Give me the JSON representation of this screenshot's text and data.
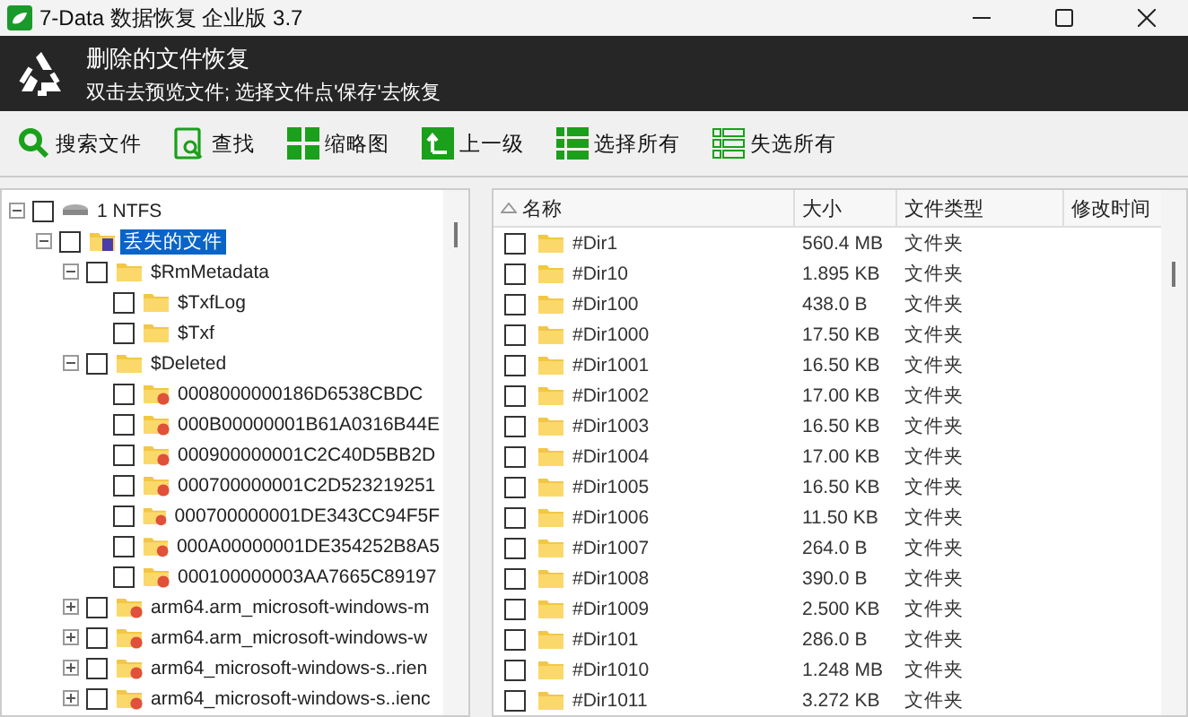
{
  "window": {
    "title": "7-Data 数据恢复 企业版 3.7"
  },
  "header": {
    "title": "删除的文件恢复",
    "subtitle": "双击去预览文件; 选择文件点'保存'去恢复"
  },
  "toolbar": [
    {
      "kind": "search",
      "label": "搜索文件"
    },
    {
      "kind": "find",
      "label": "查找"
    },
    {
      "kind": "thumbs",
      "label": "缩略图"
    },
    {
      "kind": "up",
      "label": "上一级"
    },
    {
      "kind": "selectall",
      "label": "选择所有"
    },
    {
      "kind": "deselect",
      "label": "失选所有"
    }
  ],
  "tree": [
    {
      "kind": "drive",
      "label": "1 NTFS",
      "checked": false,
      "selected": false,
      "expanded": true,
      "children": [
        {
          "kind": "lost",
          "label": "丢失的文件",
          "checked": false,
          "selected": true,
          "expanded": true,
          "children": [
            {
              "kind": "folder",
              "label": "$RmMetadata",
              "checked": false,
              "selected": false,
              "expanded": true,
              "children": [
                {
                  "kind": "folder",
                  "label": "$TxfLog",
                  "checked": false,
                  "selected": false
                },
                {
                  "kind": "folder",
                  "label": "$Txf",
                  "checked": false,
                  "selected": false
                }
              ]
            },
            {
              "kind": "folder",
              "label": "$Deleted",
              "checked": false,
              "selected": false,
              "expanded": true,
              "children": [
                {
                  "kind": "deleted",
                  "label": "0008000000186D6538CBDC",
                  "checked": false,
                  "selected": false
                },
                {
                  "kind": "deleted",
                  "label": "000B00000001B61A0316B44E",
                  "checked": false,
                  "selected": false
                },
                {
                  "kind": "deleted",
                  "label": "000900000001C2C40D5BB2D",
                  "checked": false,
                  "selected": false
                },
                {
                  "kind": "deleted",
                  "label": "000700000001C2D523219251",
                  "checked": false,
                  "selected": false
                },
                {
                  "kind": "deleted",
                  "label": "000700000001DE343CC94F5F",
                  "checked": false,
                  "selected": false
                },
                {
                  "kind": "deleted",
                  "label": "000A00000001DE354252B8A5",
                  "checked": false,
                  "selected": false
                },
                {
                  "kind": "deleted",
                  "label": "000100000003AA7665C89197",
                  "checked": false,
                  "selected": false
                }
              ]
            },
            {
              "kind": "deleted",
              "label": "arm64.arm_microsoft-windows-m",
              "checked": false,
              "selected": false,
              "expanded": false
            },
            {
              "kind": "deleted",
              "label": "arm64.arm_microsoft-windows-w",
              "checked": false,
              "selected": false,
              "expanded": false
            },
            {
              "kind": "deleted",
              "label": "arm64_microsoft-windows-s..rien",
              "checked": false,
              "selected": false,
              "expanded": false
            },
            {
              "kind": "deleted",
              "label": "arm64_microsoft-windows-s..ienc",
              "checked": false,
              "selected": false,
              "expanded": false
            }
          ]
        }
      ]
    }
  ],
  "table": {
    "columns": [
      "名称",
      "大小",
      "文件类型",
      "修改时间"
    ],
    "rows": [
      {
        "name": "#Dir1",
        "size": "560.4 MB",
        "type": "文件夹",
        "checked": false
      },
      {
        "name": "#Dir10",
        "size": "1.895 KB",
        "type": "文件夹",
        "checked": false
      },
      {
        "name": "#Dir100",
        "size": "438.0 B",
        "type": "文件夹",
        "checked": false
      },
      {
        "name": "#Dir1000",
        "size": "17.50 KB",
        "type": "文件夹",
        "checked": false
      },
      {
        "name": "#Dir1001",
        "size": "16.50 KB",
        "type": "文件夹",
        "checked": false
      },
      {
        "name": "#Dir1002",
        "size": "17.00 KB",
        "type": "文件夹",
        "checked": false
      },
      {
        "name": "#Dir1003",
        "size": "16.50 KB",
        "type": "文件夹",
        "checked": false
      },
      {
        "name": "#Dir1004",
        "size": "17.00 KB",
        "type": "文件夹",
        "checked": false
      },
      {
        "name": "#Dir1005",
        "size": "16.50 KB",
        "type": "文件夹",
        "checked": false
      },
      {
        "name": "#Dir1006",
        "size": "11.50 KB",
        "type": "文件夹",
        "checked": false
      },
      {
        "name": "#Dir1007",
        "size": "264.0 B",
        "type": "文件夹",
        "checked": false
      },
      {
        "name": "#Dir1008",
        "size": "390.0 B",
        "type": "文件夹",
        "checked": false
      },
      {
        "name": "#Dir1009",
        "size": "2.500 KB",
        "type": "文件夹",
        "checked": false
      },
      {
        "name": "#Dir101",
        "size": "286.0 B",
        "type": "文件夹",
        "checked": false
      },
      {
        "name": "#Dir1010",
        "size": "1.248 MB",
        "type": "文件夹",
        "checked": false
      },
      {
        "name": "#Dir1011",
        "size": "3.272 KB",
        "type": "文件夹",
        "checked": false
      }
    ]
  }
}
